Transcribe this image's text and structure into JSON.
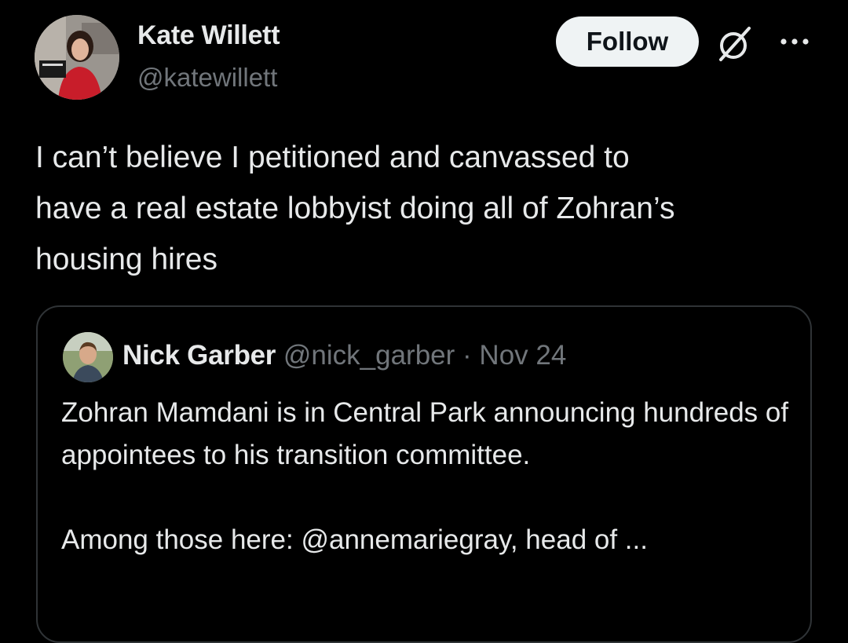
{
  "author": {
    "name": "Kate Willett",
    "handle": "@katewillett"
  },
  "actions": {
    "follow_label": "Follow",
    "grok_icon": "grok-slash-icon",
    "more_icon": "more-dots-icon"
  },
  "tweet": {
    "text": "I can’t believe I petitioned and canvassed to\nhave a real estate lobbyist doing all of Zohran’s\nhousing hires"
  },
  "quote": {
    "name": "Nick Garber",
    "handle": "@nick_garber",
    "separator": "·",
    "date": "Nov 24",
    "paragraph1": "Zohran Mamdani is in Central Park announcing hundreds of appointees to his transition committee.",
    "paragraph2": "Among those here: @annemariegray, head of ..."
  },
  "colors": {
    "background": "#000000",
    "text_primary": "#e7e9ea",
    "text_secondary": "#71767b",
    "follow_bg": "#eff3f4",
    "border": "#2f3336"
  }
}
